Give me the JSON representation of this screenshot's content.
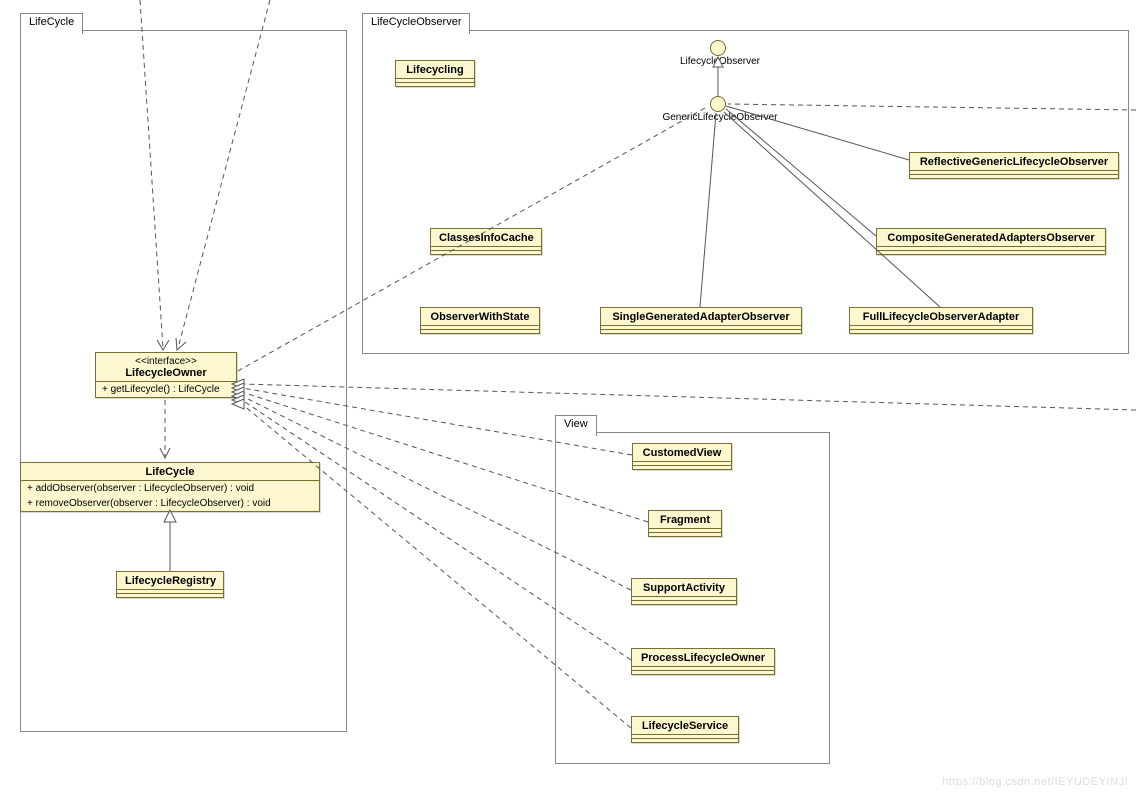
{
  "watermark": "https://blog.csdn.net/IEYUDEYINJI",
  "packages": {
    "lifecycle": {
      "label": "LifeCycle"
    },
    "observer": {
      "label": "LifeCycleObserver"
    },
    "view": {
      "label": "View"
    }
  },
  "interfaces": {
    "lifecycleObserver": {
      "label": "LifecycleObserver"
    },
    "genericLifecycleObserver": {
      "label": "GenericLifecycleObserver"
    }
  },
  "classes": {
    "lifecycleOwner": {
      "stereotype": "<<interface>>",
      "name": "LifecycleOwner",
      "ops": [
        "+ getLifecycle() : LifeCycle"
      ]
    },
    "lifecycle": {
      "name": "LifeCycle",
      "ops": [
        "+ addObserver(observer : LifecycleObserver) : void",
        "+ removeObserver(observer : LifecycleObserver) : void"
      ]
    },
    "lifecycleRegistry": {
      "name": "LifecycleRegistry"
    },
    "lifecycling": {
      "name": "Lifecycling"
    },
    "classesInfoCache": {
      "name": "ClassesInfoCache"
    },
    "observerWithState": {
      "name": "ObserverWithState"
    },
    "singleGeneratedAdapterObserver": {
      "name": "SingleGeneratedAdapterObserver"
    },
    "fullLifecycleObserverAdapter": {
      "name": "FullLifecycleObserverAdapter"
    },
    "reflectiveGenericLifecycleObserver": {
      "name": "ReflectiveGenericLifecycleObserver"
    },
    "compositeGeneratedAdaptersObserver": {
      "name": "CompositeGeneratedAdaptersObserver"
    },
    "customedView": {
      "name": "CustomedView"
    },
    "fragment": {
      "name": "Fragment"
    },
    "supportActivity": {
      "name": "SupportActivity"
    },
    "processLifecycleOwner": {
      "name": "ProcessLifecycleOwner"
    },
    "lifecycleService": {
      "name": "LifecycleService"
    }
  }
}
